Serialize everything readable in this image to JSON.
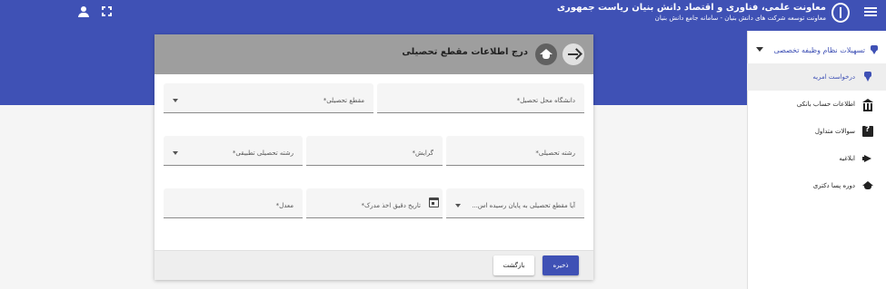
{
  "header": {
    "title": "معاونت علمی، فناوری و اقتصاد دانش بنیان ریاست جمهوری",
    "subtitle": "معاونت توسعه شرکت های دانش بنیان - سامانه جامع دانش بنیان",
    "menu_icon": "menu-icon",
    "user_icon": "account-icon",
    "fullscreen_icon": "fullscreen-icon"
  },
  "sidebar": {
    "group_label": "تسهیلات نظام وظیفه تخصصی",
    "items": [
      {
        "label": "درخواست امریه",
        "icon": "ribbon-icon",
        "active": true
      },
      {
        "label": "اطلاعات حساب بانکی",
        "icon": "bank-icon"
      },
      {
        "label": "سوالات متداول",
        "icon": "faq-icon"
      },
      {
        "label": "ابلاغیه",
        "icon": "megaphone-icon"
      },
      {
        "label": "دوره پسا دکتری",
        "icon": "graduation-cap-icon"
      }
    ]
  },
  "form": {
    "title": "درج اطلاعات مقطع تحصیلی",
    "fields": {
      "university": "دانشگاه محل تحصیل*",
      "degree": "مقطع تحصیلی*",
      "major": "رشته تحصیلی*",
      "orientation": "گرایش*",
      "applied_major": "رشته تحصیلی تطبیقی*",
      "completed": "آیا مقطع تحصیلی به پایان رسیده اس...",
      "grad_date": "تاریخ دقیق اخذ مدرک*",
      "gpa": "معدل*"
    },
    "save_label": "ذخیره",
    "back_label": "بازگشت"
  },
  "colors": {
    "primary": "#3f51b5",
    "card_header": "#9e9e9e",
    "background": "#f5f5f5"
  }
}
